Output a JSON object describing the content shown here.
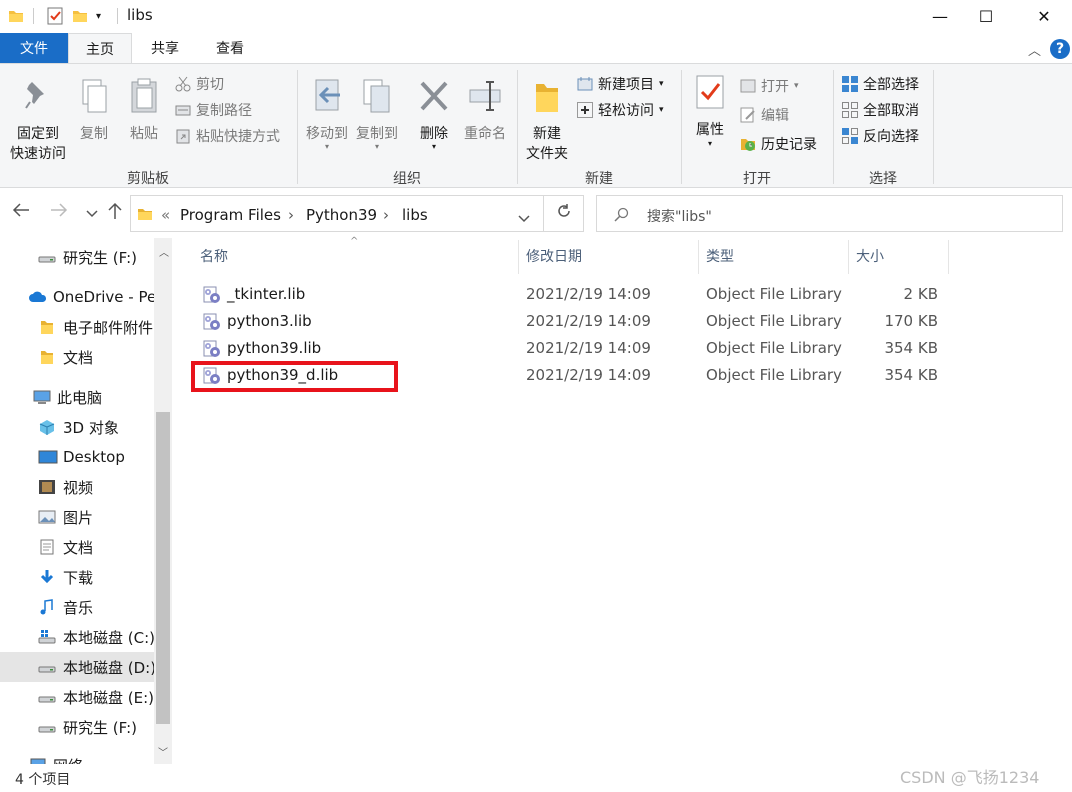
{
  "window": {
    "title": "libs",
    "controls": {
      "minimize": "—",
      "maximize": "☐",
      "close": "✕"
    }
  },
  "ribbon_tabs": [
    {
      "label": "文件"
    },
    {
      "label": "主页"
    },
    {
      "label": "共享"
    },
    {
      "label": "查看"
    }
  ],
  "ribbon": {
    "clipboard": {
      "pin_line1": "固定到",
      "pin_line2": "快速访问",
      "copy": "复制",
      "paste": "粘贴",
      "cut": "剪切",
      "copy_path": "复制路径",
      "paste_shortcut": "粘贴快捷方式",
      "group": "剪贴板"
    },
    "organize": {
      "move_to": "移动到",
      "copy_to": "复制到",
      "delete": "删除",
      "rename": "重命名",
      "group": "组织"
    },
    "new": {
      "new_item": "新建项目",
      "easy_access": "轻松访问",
      "new_folder_line1": "新建",
      "new_folder_line2": "文件夹",
      "group": "新建"
    },
    "open": {
      "properties": "属性",
      "open": "打开",
      "edit": "编辑",
      "history": "历史记录",
      "group": "打开"
    },
    "select": {
      "select_all": "全部选择",
      "select_none": "全部取消",
      "invert": "反向选择",
      "group": "选择"
    }
  },
  "address": {
    "overflow": "«",
    "crumbs": [
      "Program Files",
      "Python39",
      "libs"
    ],
    "search_placeholder": "搜索\"libs\""
  },
  "nav_pane": [
    {
      "label": "研究生 (F:)",
      "icon": "drive-icon"
    },
    {
      "label": "OneDrive - Pe",
      "icon": "cloud-icon"
    },
    {
      "label": "电子邮件附件",
      "icon": "folder-icon"
    },
    {
      "label": "文档",
      "icon": "folder-icon"
    },
    {
      "label": "此电脑",
      "icon": "computer-icon"
    },
    {
      "label": "3D 对象",
      "icon": "cube-icon"
    },
    {
      "label": "Desktop",
      "icon": "desktop-icon"
    },
    {
      "label": "视频",
      "icon": "film-icon"
    },
    {
      "label": "图片",
      "icon": "picture-icon"
    },
    {
      "label": "文档",
      "icon": "document-icon"
    },
    {
      "label": "下载",
      "icon": "download-icon"
    },
    {
      "label": "音乐",
      "icon": "music-icon"
    },
    {
      "label": "本地磁盘 (C:)",
      "icon": "windows-drive-icon"
    },
    {
      "label": "本地磁盘 (D:)",
      "icon": "drive-icon"
    },
    {
      "label": "本地磁盘 (E:)",
      "icon": "drive-icon"
    },
    {
      "label": "研究生 (F:)",
      "icon": "drive-icon"
    },
    {
      "label": "网络",
      "icon": "network-icon"
    }
  ],
  "columns": {
    "name": "名称",
    "date": "修改日期",
    "type": "类型",
    "size": "大小"
  },
  "files": [
    {
      "name": "_tkinter.lib",
      "date": "2021/2/19 14:09",
      "type": "Object File Library",
      "size": "2 KB"
    },
    {
      "name": "python3.lib",
      "date": "2021/2/19 14:09",
      "type": "Object File Library",
      "size": "170 KB"
    },
    {
      "name": "python39.lib",
      "date": "2021/2/19 14:09",
      "type": "Object File Library",
      "size": "354 KB"
    },
    {
      "name": "python39_d.lib",
      "date": "2021/2/19 14:09",
      "type": "Object File Library",
      "size": "354 KB"
    }
  ],
  "status": {
    "count": "4 个项目"
  },
  "watermark": "CSDN @飞扬1234",
  "colors": {
    "file_tab": "#1a6dc7",
    "highlight_box": "#e8131b",
    "help": "#1a6dc7"
  }
}
